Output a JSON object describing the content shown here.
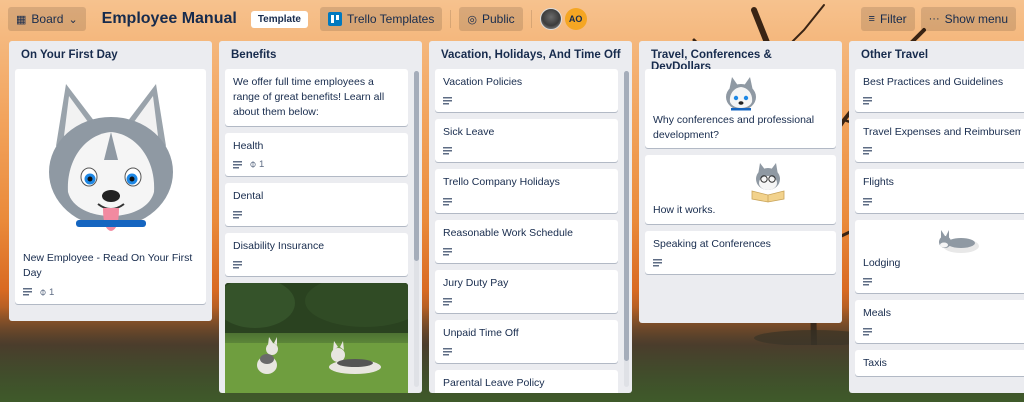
{
  "header": {
    "board_button": "Board",
    "title": "Employee Manual",
    "template_badge": "Template",
    "team_button": "Trello Templates",
    "visibility_button": "Public",
    "avatar_initials": "AO",
    "filter_button": "Filter",
    "menu_button": "Show menu"
  },
  "lists": [
    {
      "title": "On Your First Day",
      "cards": [
        {
          "title": "New Employee - Read On Your First Day",
          "attachments": "1"
        }
      ]
    },
    {
      "title": "Benefits",
      "cards": [
        {
          "title": "We offer full time employees a range of great benefits! Learn all about them below:"
        },
        {
          "title": "Health",
          "attachments": "1"
        },
        {
          "title": "Dental"
        },
        {
          "title": "Disability Insurance"
        }
      ]
    },
    {
      "title": "Vacation, Holidays, And Time Off",
      "cards": [
        {
          "title": "Vacation Policies"
        },
        {
          "title": "Sick Leave"
        },
        {
          "title": "Trello Company Holidays"
        },
        {
          "title": "Reasonable Work Schedule"
        },
        {
          "title": "Jury Duty Pay"
        },
        {
          "title": "Unpaid Time Off"
        },
        {
          "title": "Parental Leave Policy"
        }
      ]
    },
    {
      "title": "Travel, Conferences & DevDollars",
      "cards": [
        {
          "title": "Why conferences and professional development?"
        },
        {
          "title": "How it works."
        },
        {
          "title": "Speaking at Conferences"
        }
      ]
    },
    {
      "title": "Other Travel",
      "cards": [
        {
          "title": "Best Practices and Guidelines"
        },
        {
          "title": "Travel Expenses and Reimbursement"
        },
        {
          "title": "Flights"
        },
        {
          "title": "Lodging"
        },
        {
          "title": "Meals"
        },
        {
          "title": "Taxis"
        }
      ]
    }
  ],
  "icons": {
    "board": "board-icon",
    "dropdown": "chevron-down-icon",
    "visibility": "globe-icon",
    "filter": "filter-icon",
    "menu": "more-icon",
    "description": "description-icon",
    "attachment": "paperclip-icon"
  },
  "colors": {
    "list_bg": "#ebecf0",
    "card_bg": "#ffffff",
    "trello_blue": "#0079bf",
    "avatar_orange": "#f5a623"
  }
}
